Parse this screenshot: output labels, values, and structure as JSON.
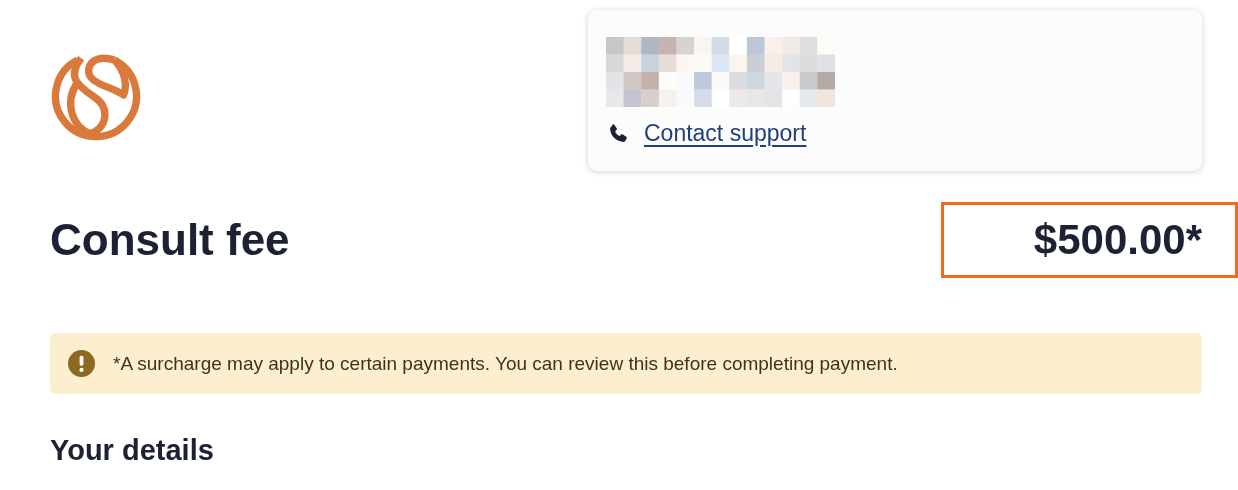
{
  "header": {
    "support_card": {
      "link": "Contact support"
    }
  },
  "fee": {
    "title": "Consult fee",
    "amount": "$500.00*",
    "highlighted": true
  },
  "notice": {
    "kind": "warning",
    "text": "*A surcharge may apply to certain payments. You can review this before completing payment."
  },
  "section_heading": "Your details"
}
